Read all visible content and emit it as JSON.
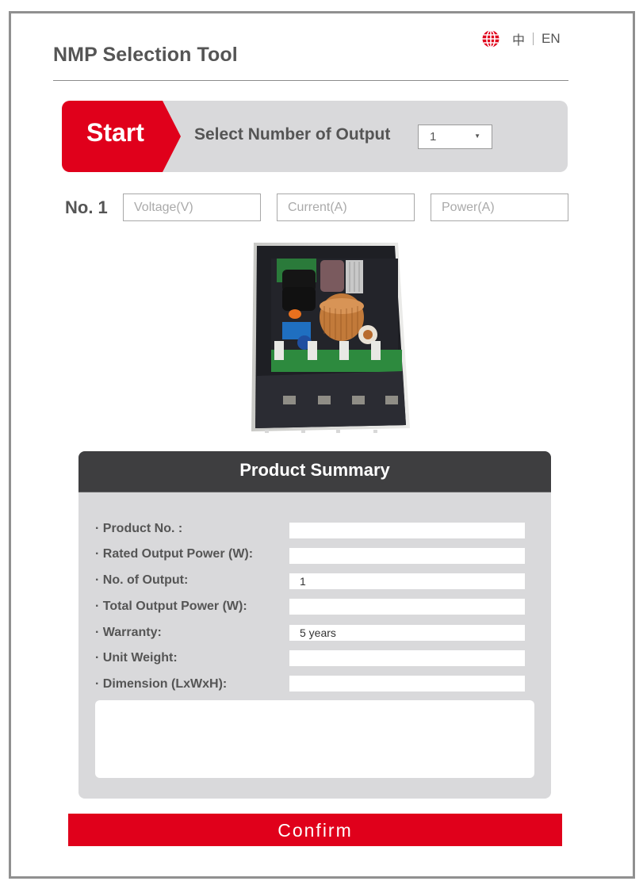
{
  "header": {
    "title": "NMP Selection Tool",
    "language": {
      "icon": "globe-icon",
      "options": [
        "中",
        "EN"
      ],
      "accent_color": "#e0001b"
    }
  },
  "start_bar": {
    "start_label": "Start",
    "select_label": "Select Number of Output",
    "selected_output": "1",
    "dropdown_icon": "triangle-down-icon",
    "accent_color": "#e0001b"
  },
  "output_row": {
    "label": "No. 1",
    "voltage_placeholder": "Voltage(V)",
    "current_placeholder": "Current(A)",
    "power_placeholder": "Power(A)",
    "voltage_value": "",
    "current_value": "",
    "power_value": ""
  },
  "product_image": {
    "alt": "Open power supply unit with internal PCB components"
  },
  "summary": {
    "title": "Product Summary",
    "rows": [
      {
        "label": "· Product No. :",
        "value": ""
      },
      {
        "label": "· Rated Output Power (W):",
        "value": ""
      },
      {
        "label": "· No. of Output:",
        "value": "1"
      },
      {
        "label": "· Total Output Power (W):",
        "value": ""
      },
      {
        "label": "· Warranty:",
        "value": "5 years"
      },
      {
        "label": "· Unit Weight:",
        "value": ""
      },
      {
        "label": "· Dimension (LxWxH):",
        "value": ""
      }
    ],
    "notes_value": ""
  },
  "confirm_label": "Confirm"
}
